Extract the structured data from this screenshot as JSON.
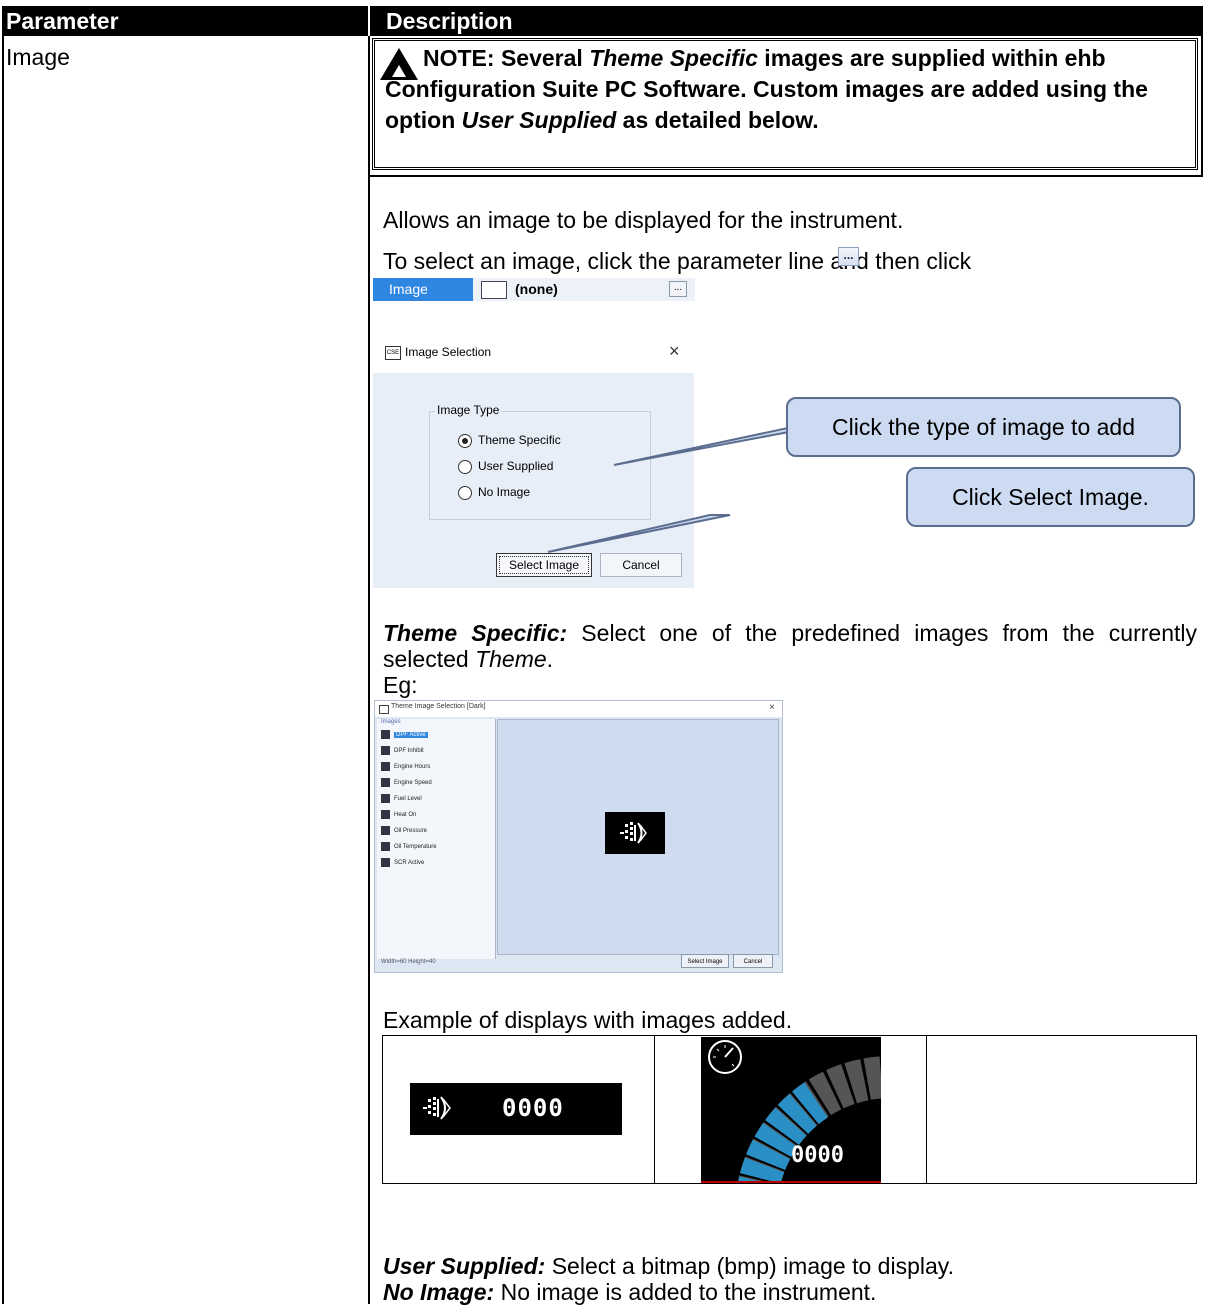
{
  "table": {
    "header_parameter": "Parameter",
    "header_description": "Description",
    "parameter_name": "Image"
  },
  "note": {
    "prefix": "NOTE: Several ",
    "emph1": "Theme Specific",
    "mid": " images are supplied within ehb Configuration Suite PC Software. Custom images are added using the option ",
    "emph2": "User Supplied",
    "suffix": " as detailed below."
  },
  "intro": {
    "line1": "Allows an image to be displayed for the instrument.",
    "line2": "To select an image, click the parameter line and then click"
  },
  "param_line": {
    "label": "Image",
    "value": "(none)",
    "button": "..."
  },
  "dialog": {
    "title": "Image Selection",
    "group": "Image Type",
    "options": [
      "Theme Specific",
      "User Supplied",
      "No Image"
    ],
    "selected_index": 0,
    "select_button": "Select Image",
    "cancel_button": "Cancel"
  },
  "callouts": {
    "type": "Click the type of image to add",
    "select": "Click Select Image."
  },
  "theme_specific": {
    "term": "Theme Specific:",
    "text": "  Select one of the predefined images from the currently selected ",
    "theme_word": "Theme",
    "end": ".",
    "eg": "Eg:"
  },
  "theme_dialog": {
    "title": "Theme Image Selection [Dark]",
    "list_header": "Images",
    "items": [
      "DPF Active",
      "DPF Inhibit",
      "Engine Hours",
      "Engine Speed",
      "Fuel Level",
      "Heat On",
      "Oil Pressure",
      "Oil Temperature",
      "SCR Active"
    ],
    "status": "Width=60 Height=40",
    "select_button": "Select Image",
    "cancel_button": "Cancel"
  },
  "examples": {
    "caption": "Example of displays with images added.",
    "readout": "0000"
  },
  "user_supplied": {
    "term": "User Supplied:",
    "text": " Select a bitmap (bmp) image to display."
  },
  "no_image": {
    "term": "No Image:",
    "text": " No image is added to the instrument."
  }
}
